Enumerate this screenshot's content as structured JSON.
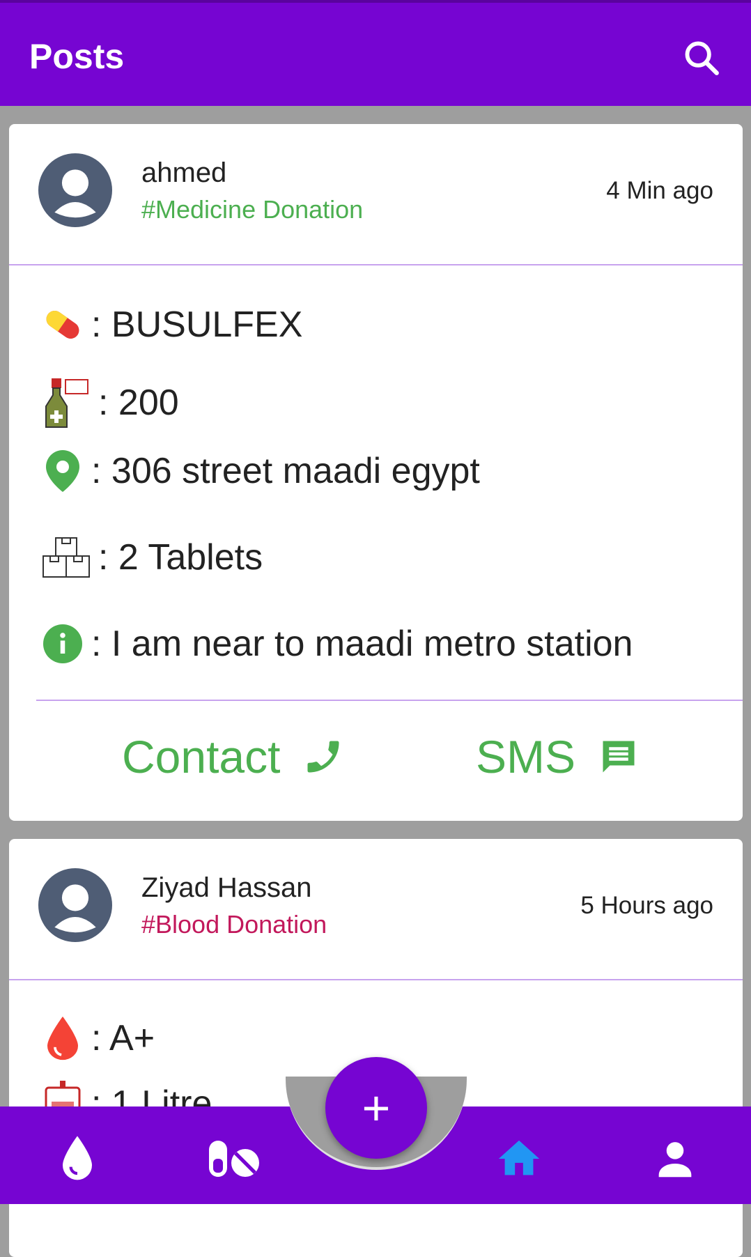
{
  "appbar": {
    "title": "Posts",
    "search_icon": "search-icon"
  },
  "posts": [
    {
      "user": "ahmed",
      "tag": "#Medicine Donation",
      "time": "4 Min ago",
      "details": {
        "medicine": ": BUSULFEX",
        "price": ": 200",
        "location": ": 306 street maadi egypt",
        "quantity": ": 2 Tablets",
        "note": ": I am near to maadi metro station"
      },
      "actions": {
        "contact": "Contact",
        "sms": "SMS"
      }
    },
    {
      "user": "Ziyad Hassan",
      "tag": "#Blood Donation",
      "time": "5 Hours ago",
      "details": {
        "blood_type": ": A+",
        "amount": ": 1 Litre"
      }
    }
  ],
  "nav": {
    "items": [
      "blood-drop-icon",
      "pills-icon",
      "home-icon",
      "person-icon"
    ],
    "fab": "+",
    "active": "home"
  },
  "colors": {
    "primary": "#7605d2",
    "accent_green": "#4caf50",
    "blood_pink": "#c2185b",
    "active_nav": "#2196f3"
  }
}
